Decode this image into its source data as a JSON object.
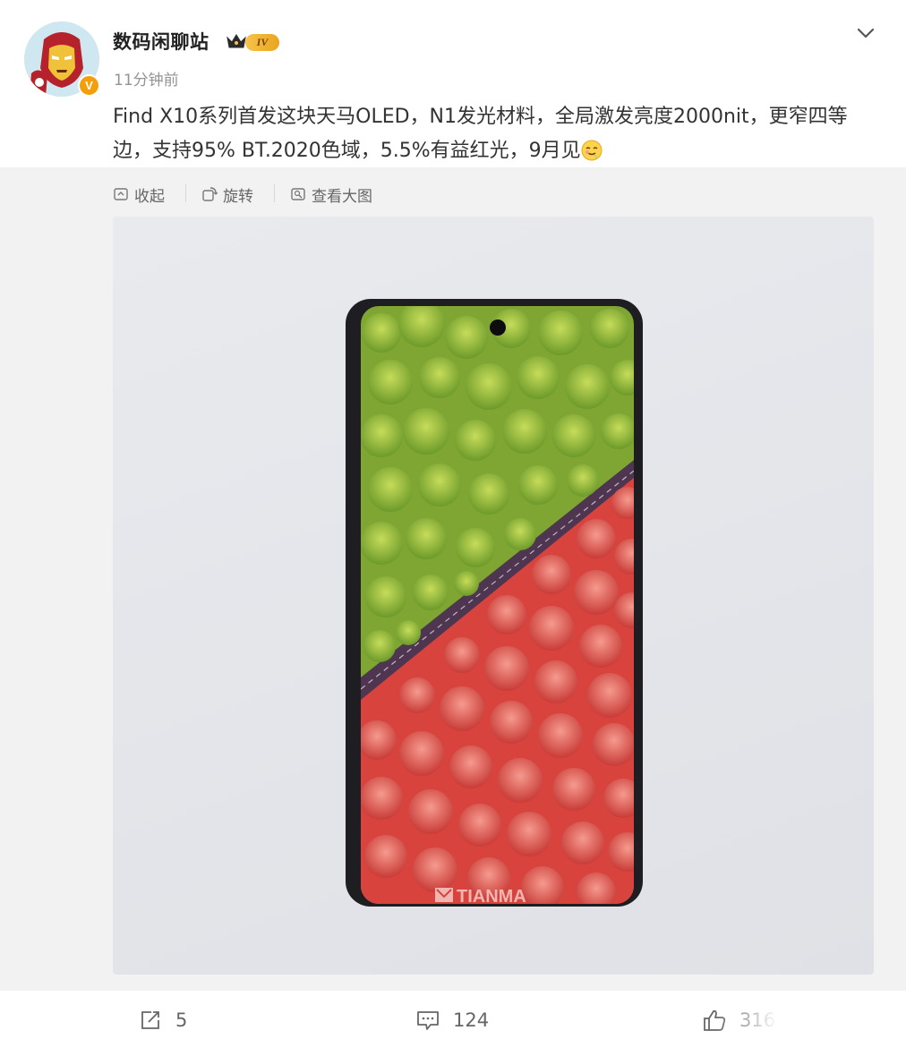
{
  "post": {
    "username": "数码闲聊站",
    "verified_badge": "V",
    "level_badge": "IV",
    "timestamp": "11分钟前",
    "text": "Find X10系列首发这块天马OLED，N1发光材料，全局激发亮度2000nit，更窄四等边，支持95% BT.2020色域，5.5%有益红光，9月见",
    "emoji": "drooling-face-icon",
    "more_icon": "chevron-down-icon"
  },
  "media_toolbar": {
    "collapse_label": "收起",
    "rotate_label": "旋转",
    "view_large_label": "查看大图"
  },
  "image": {
    "watermark": "TIANMA",
    "top_color": "#9bc03a",
    "bottom_color": "#e8554f",
    "road_color": "#5a3e55"
  },
  "actions": {
    "repost_count": "5",
    "comment_count": "124",
    "like_count": "316"
  },
  "colors": {
    "text": "#333333",
    "muted": "#939393",
    "badge_orange": "#f59e0b",
    "background": "#f2f2f2"
  }
}
